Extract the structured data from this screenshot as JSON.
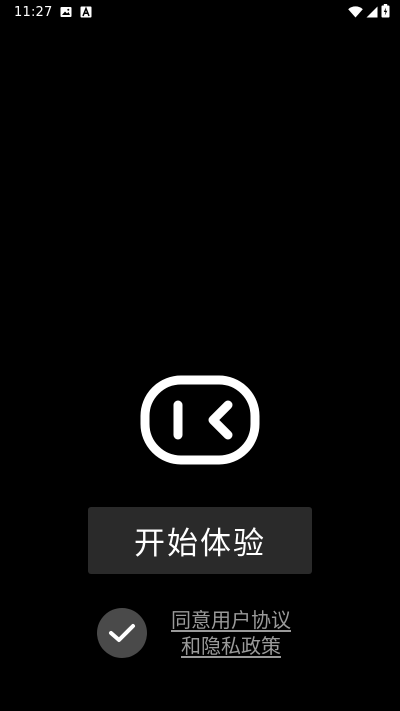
{
  "status_bar": {
    "time": "11:27",
    "left_icons": [
      "image-icon",
      "a-icon"
    ],
    "right_icons": [
      "wifi-icon",
      "signal-icon",
      "battery-icon"
    ]
  },
  "logo": {
    "icon": "play-back-icon",
    "color": "#ffffff"
  },
  "start_button": {
    "label": "开始体验",
    "background": "#2a2a2a"
  },
  "agreement": {
    "checked": true,
    "check_icon": "checkmark-icon",
    "line1": "同意用户协议",
    "line2": "和隐私政策",
    "text_color": "#9a9a9a"
  }
}
